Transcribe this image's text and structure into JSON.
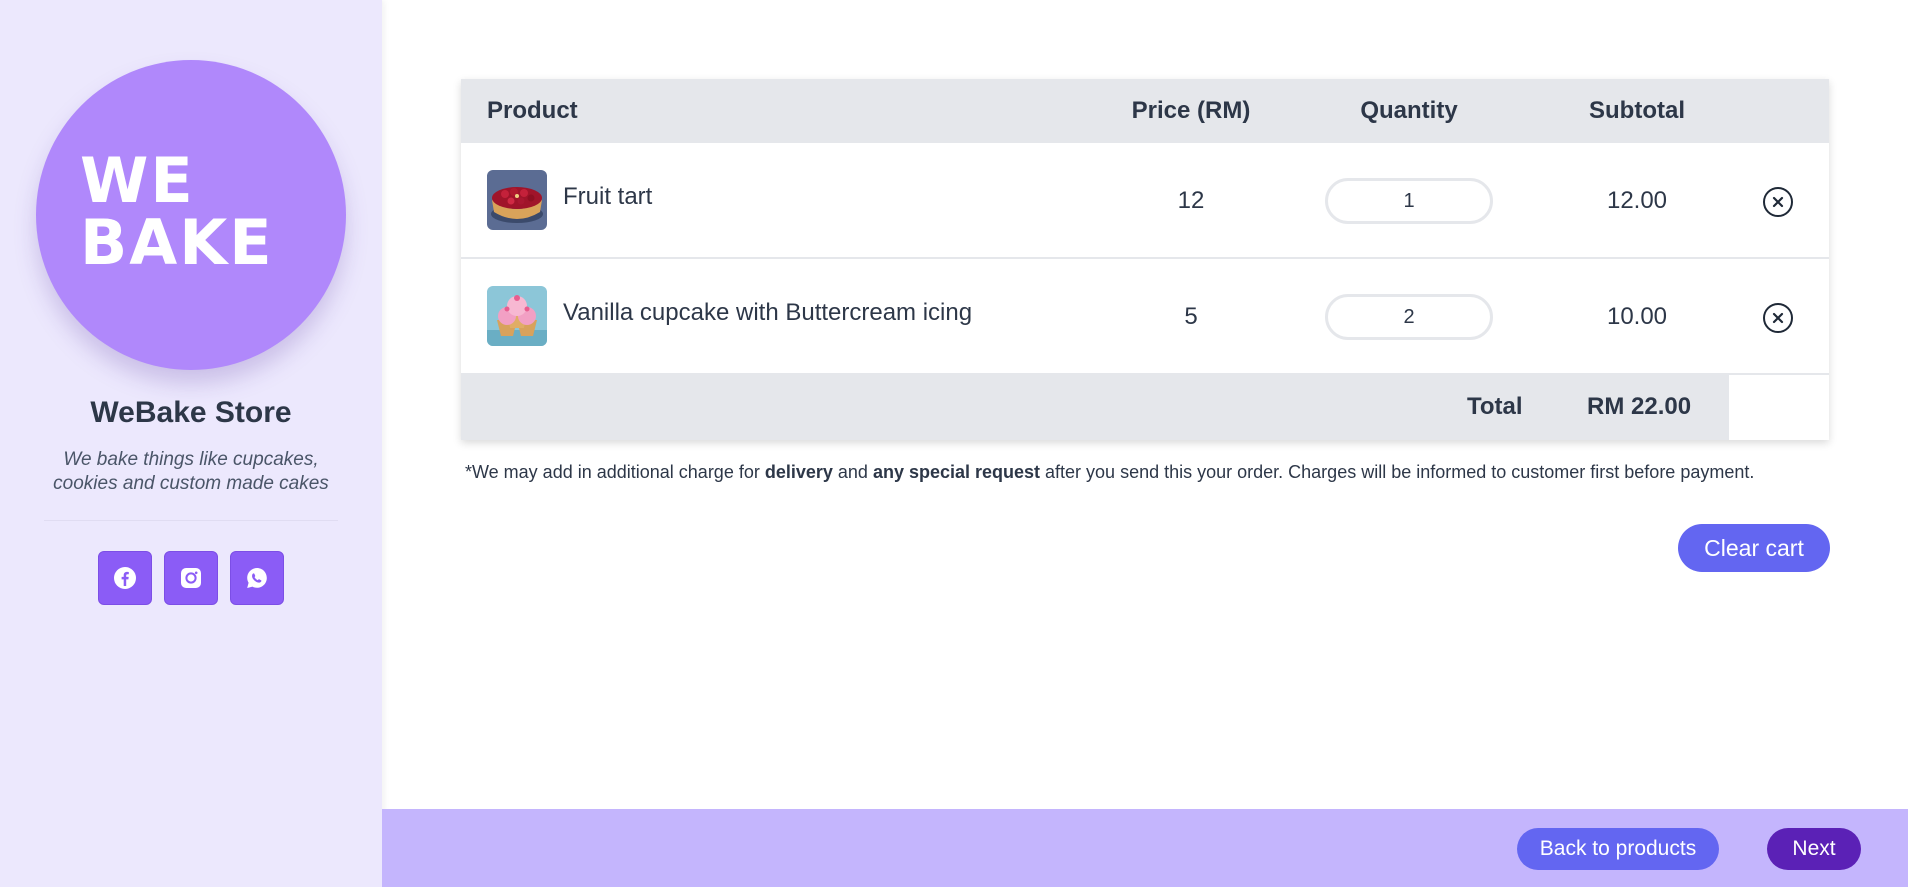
{
  "sidebar": {
    "logo_line1": "WE",
    "logo_line2": "BAKE",
    "store_name": "WeBake Store",
    "tagline": "We bake things like cupcakes, cookies and custom made cakes",
    "socials": [
      {
        "icon": "facebook-icon"
      },
      {
        "icon": "instagram-icon"
      },
      {
        "icon": "whatsapp-icon"
      }
    ]
  },
  "cart": {
    "headers": {
      "product": "Product",
      "price": "Price (RM)",
      "quantity": "Quantity",
      "subtotal": "Subtotal"
    },
    "items": [
      {
        "image": "fruit-tart-image",
        "name": "Fruit tart",
        "price": "12",
        "quantity": "1",
        "subtotal": "12.00"
      },
      {
        "image": "vanilla-cupcake-image",
        "name": "Vanilla cupcake with Buttercream icing",
        "price": "5",
        "quantity": "2",
        "subtotal": "10.00"
      }
    ],
    "total_label": "Total",
    "total_value": "RM 22.00"
  },
  "note": {
    "part1": "*We may add in additional charge for ",
    "bold1": "delivery",
    "part2": " and ",
    "bold2": "any special request",
    "part3": " after you send this your order. Charges will be informed to customer first before payment."
  },
  "actions": {
    "clear_cart": "Clear cart",
    "back_to_products": "Back to products",
    "next": "Next"
  },
  "colors": {
    "sidebar_bg": "#ece8fd",
    "logo_bg": "#b088fb",
    "social_bg": "#8b5cf6",
    "button_primary": "#6366f1",
    "button_next": "#5b21b6",
    "footer_bg": "#c4b5fd"
  }
}
